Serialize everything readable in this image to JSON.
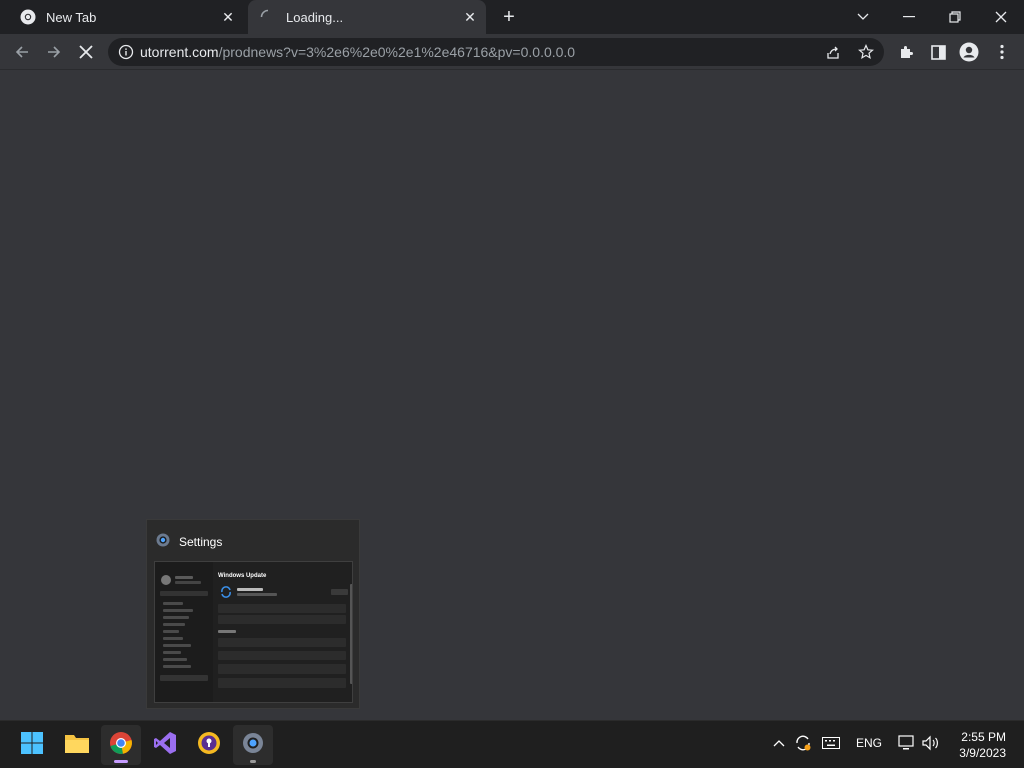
{
  "browser": {
    "tabs": [
      {
        "title": "New Tab",
        "favicon": "chrome-icon",
        "state": "inactive"
      },
      {
        "title": "Loading...",
        "favicon": "loading-spinner-icon",
        "state": "active"
      }
    ],
    "omnibox": {
      "url_host": "utorrent.com",
      "url_path": "/prodnews?v=3%2e6%2e0%2e1%2e46716&pv=0.0.0.0.0"
    }
  },
  "preview": {
    "app_title": "Settings",
    "thumbnail_heading": "Windows Update"
  },
  "taskbar": {
    "apps": [
      "start-icon",
      "file-explorer-icon",
      "chrome-icon",
      "visual-studio-icon",
      "vpn-shield-icon",
      "settings-icon"
    ],
    "language": "ENG",
    "time": "2:55 PM",
    "date": "3/9/2023"
  },
  "colors": {
    "tabstrip_bg": "#202124",
    "content_bg": "#35363a",
    "taskbar_bg": "#1f1f1f",
    "accent": "#8ab4f8"
  }
}
